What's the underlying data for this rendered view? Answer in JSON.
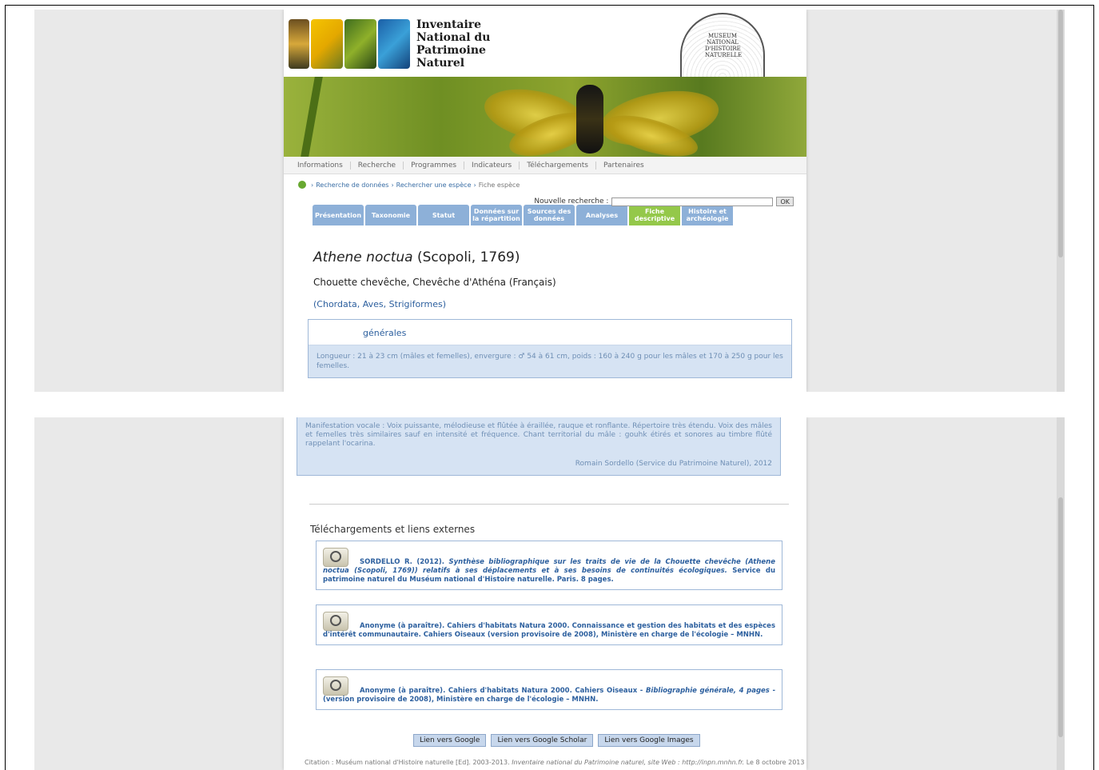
{
  "logo": {
    "line1": "Inventaire",
    "line2": "National du",
    "line3": "Patrimoine",
    "line4": "Naturel",
    "seal_text": "MUSEUM NATIONAL D'HISTOIRE NATURELLE"
  },
  "nav": [
    "Informations",
    "Recherche",
    "Programmes",
    "Indicateurs",
    "Téléchargements",
    "Partenaires"
  ],
  "breadcrumb": {
    "item1": "Recherche de données",
    "item2": "Rechercher une espèce",
    "current": "Fiche espèce"
  },
  "search": {
    "label": "Nouvelle recherche :",
    "placeholder": "",
    "ok": "OK"
  },
  "tabs": [
    "Présentation",
    "Taxonomie",
    "Statut",
    "Données sur la répartition",
    "Sources des données",
    "Analyses",
    "Fiche descriptive",
    "Histoire et archéologie"
  ],
  "species": {
    "name": "Athene noctua",
    "author": "(Scopoli, 1769)",
    "vernacular": "Chouette chevêche, Chevêche d'Athéna (Français)",
    "taxonomy": "(Chordata, Aves, Strigiformes)"
  },
  "general": {
    "heading": "générales",
    "text": "Longueur : 21 à 23 cm (mâles et femelles), envergure : ♂ 54 à 61 cm, poids : 160 à 240 g pour les mâles et 170 à 250 g pour les femelles.",
    "voice": "Manifestation vocale : Voix puissante, mélodieuse et flûtée à éraillée, rauque et ronflante. Répertoire très étendu. Voix des mâles et femelles très similaires sauf en intensité et fréquence. Chant territorial du mâle : gouhk étirés et sonores au timbre flûté rappelant l'ocarina.",
    "signature": "Romain Sordello (Service du Patrimoine Naturel), 2012"
  },
  "downloads": {
    "title": "Téléchargements et liens externes",
    "refs": [
      {
        "pre": "SORDELLO R. (2012). ",
        "italic": "Synthèse bibliographique sur les traits de vie de la Chouette chevêche (Athene noctua (Scopoli, 1769)) relatifs à ses déplacements et à ses besoins de continuités écologiques.",
        "post": " Service du patrimoine naturel du Muséum national d'Histoire naturelle. Paris. 8 pages."
      },
      {
        "pre": "Anonyme (à paraître). Cahiers d'habitats Natura 2000. Connaissance et gestion des habitats et des espèces d'intérêt communautaire. Cahiers Oiseaux (version provisoire de 2008), Ministère en charge de l'écologie – MNHN.",
        "italic": "",
        "post": ""
      },
      {
        "pre": "Anonyme (à paraître). Cahiers d'habitats Natura 2000. Cahiers Oiseaux - ",
        "italic": "Bibliographie générale, 4 pages",
        "post": " - (version provisoire de 2008), Ministère en charge de l'écologie – MNHN."
      }
    ],
    "buttons": [
      "Lien vers Google",
      "Lien vers Google Scholar",
      "Lien vers Google Images"
    ]
  },
  "citation": {
    "pre": "Citation : Muséum national d'Histoire naturelle [Ed]. 2003-2013. ",
    "italic": "Inventaire national du Patrimoine naturel, site Web : http://inpn.mnhn.fr.",
    "post": " Le 8 octobre 2013"
  }
}
